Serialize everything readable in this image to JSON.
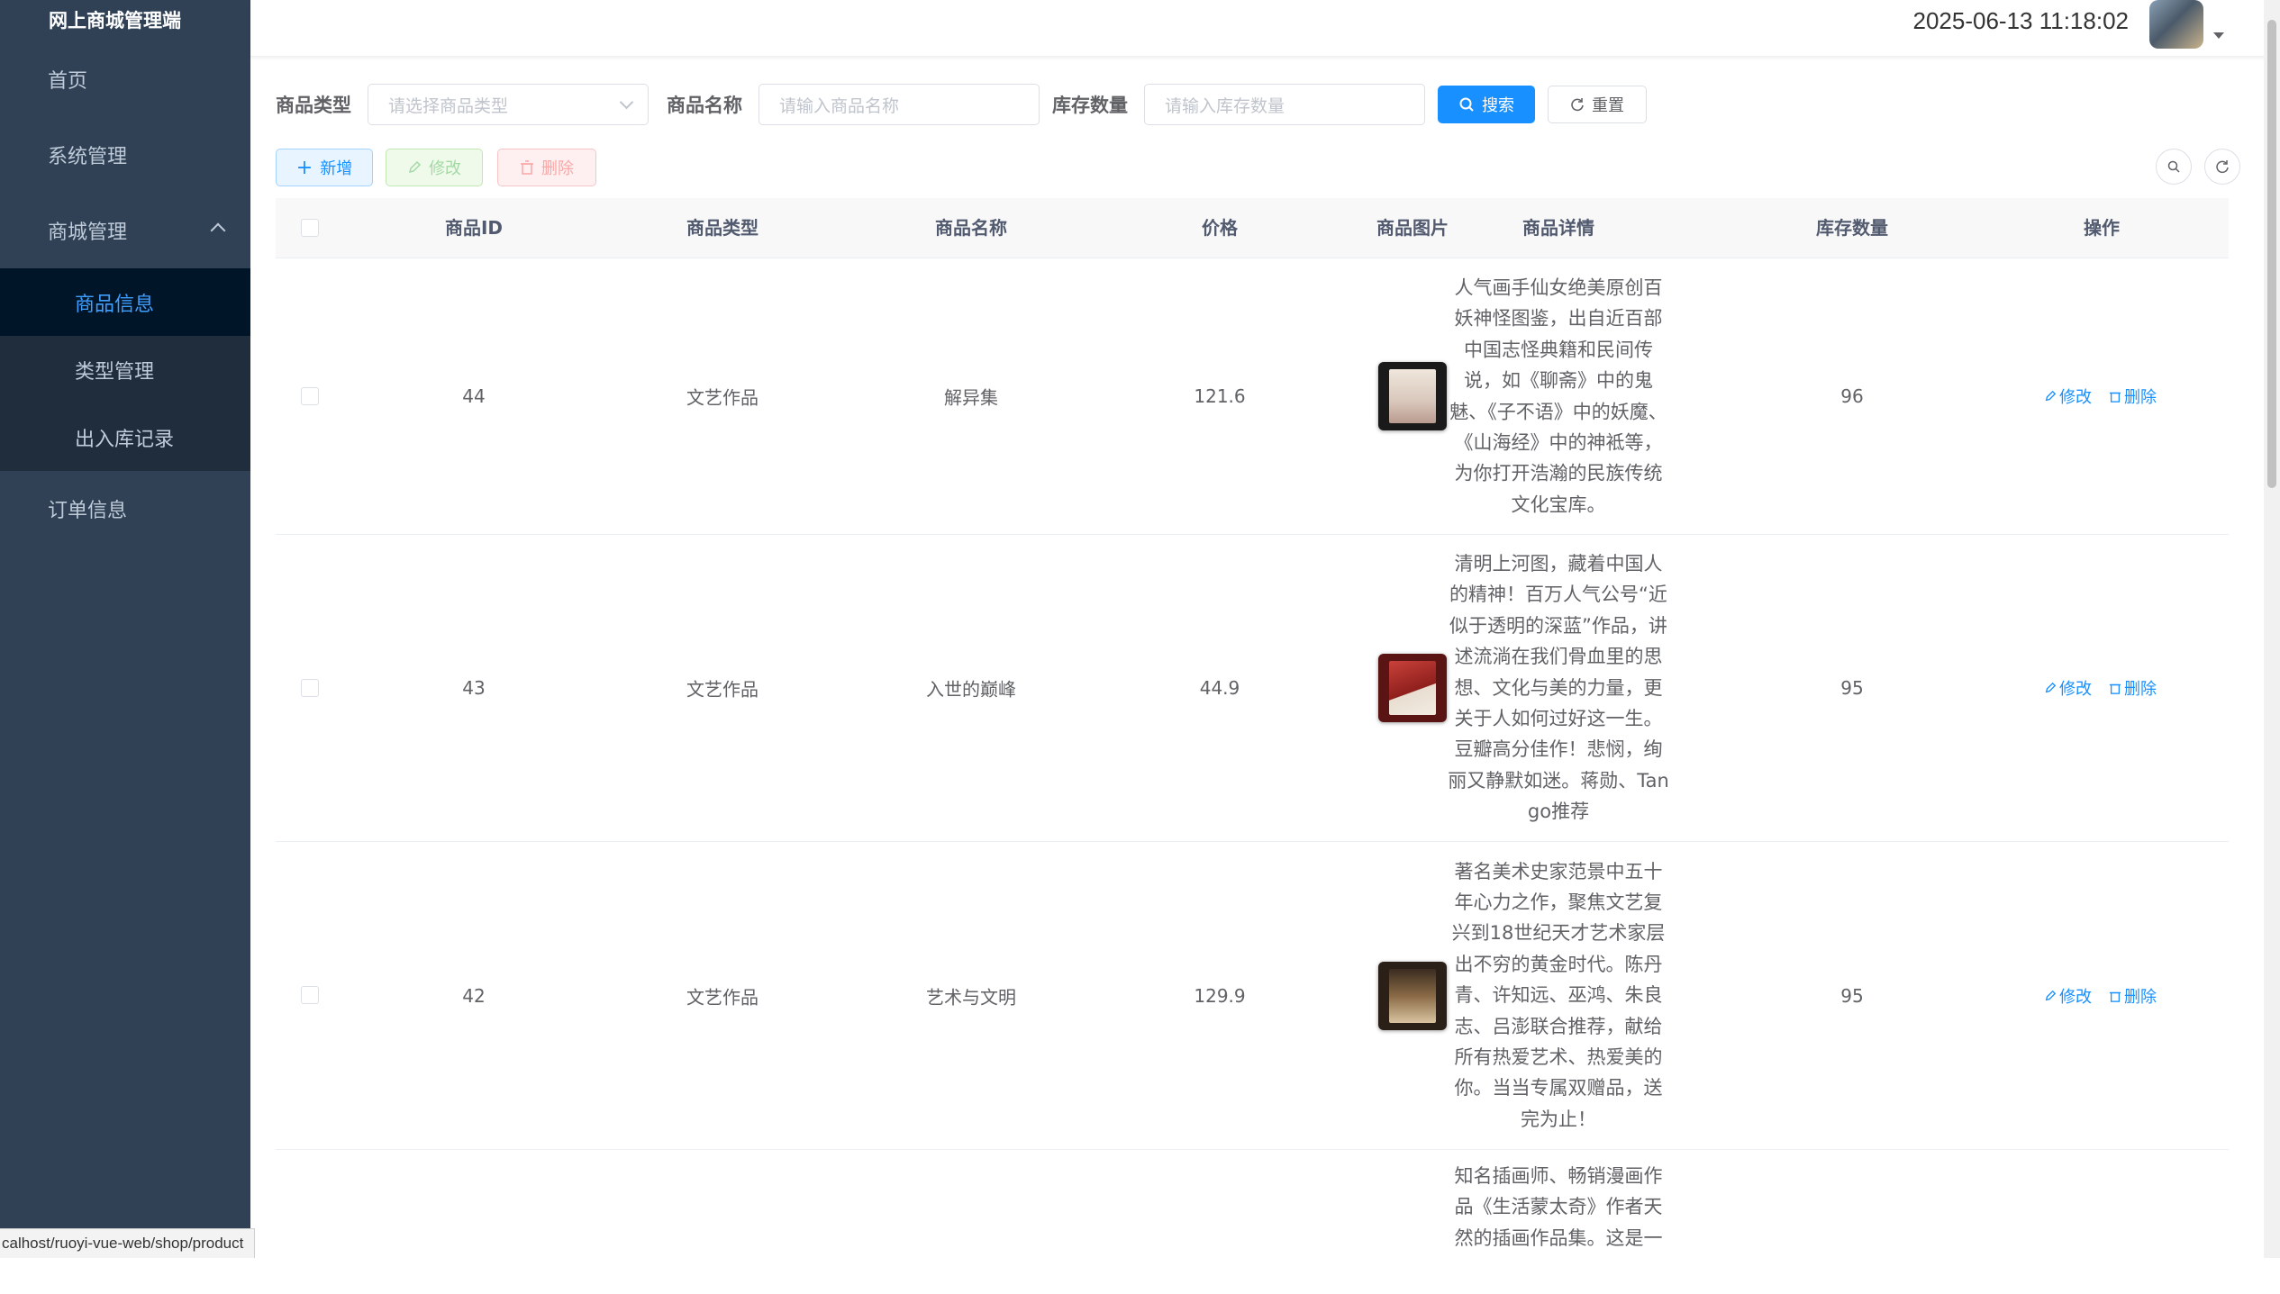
{
  "sidebar": {
    "title": "网上商城管理端",
    "menu": [
      {
        "label": "首页"
      },
      {
        "label": "系统管理"
      },
      {
        "label": "商城管理"
      },
      {
        "label": "订单信息"
      }
    ],
    "submenu": [
      {
        "label": "商品信息",
        "active": true
      },
      {
        "label": "类型管理"
      },
      {
        "label": "出入库记录"
      }
    ]
  },
  "header": {
    "datetime": "2025-06-13 11:18:02"
  },
  "search": {
    "type_label": "商品类型",
    "type_placeholder": "请选择商品类型",
    "name_label": "商品名称",
    "name_placeholder": "请输入商品名称",
    "stock_label": "库存数量",
    "stock_placeholder": "请输入库存数量",
    "search_button": "搜索",
    "reset_button": "重置"
  },
  "toolbar": {
    "add": "新增",
    "edit": "修改",
    "delete": "删除"
  },
  "table": {
    "headers": [
      "商品ID",
      "商品类型",
      "商品名称",
      "价格",
      "商品图片",
      "商品详情",
      "库存数量",
      "操作"
    ],
    "rows": [
      {
        "id": "44",
        "type": "文艺作品",
        "name": "解异集",
        "price": "121.6",
        "detail": "人气画手仙女绝美原创百妖神怪图鉴，出自近百部中国志怪典籍和民间传说，如《聊斋》中的鬼魅、《子不语》中的妖魔、《山海经》中的神袛等，为你打开浩瀚的民族传统文化宝库。",
        "stock": "96",
        "edit": "修改",
        "delete": "删除"
      },
      {
        "id": "43",
        "type": "文艺作品",
        "name": "入世的巅峰",
        "price": "44.9",
        "detail": "清明上河图，藏着中国人的精神！百万人气公号“近似于透明的深蓝”作品，讲述流淌在我们骨血里的思想、文化与美的力量，更关于人如何过好这一生。豆瓣高分佳作！悲悯，绚丽又静默如迷。蒋勋、Tango推荐",
        "stock": "95",
        "edit": "修改",
        "delete": "删除"
      },
      {
        "id": "42",
        "type": "文艺作品",
        "name": "艺术与文明",
        "price": "129.9",
        "detail": "著名美术史家范景中五十年心力之作，聚焦文艺复兴到18世纪天才艺术家层出不穷的黄金时代。陈丹青、许知远、巫鸿、朱良志、吕澎联合推荐，献给所有热爱艺术、热爱美的你。当当专属双赠品，送完为止！",
        "stock": "95",
        "edit": "修改",
        "delete": "删除"
      },
      {
        "id": "",
        "type": "",
        "name": "",
        "price": "",
        "detail": "知名插画师、畅销漫画作品《生活蒙太奇》作者天然的插画作品集。这是一",
        "stock": "",
        "edit": "",
        "delete": ""
      }
    ]
  },
  "statusbar": {
    "url": "calhost/ruoyi-vue-web/shop/product"
  },
  "colors": {
    "sidebar_bg": "#304156",
    "submenu_bg": "#1f2d3d",
    "active_bg": "#001528",
    "primary": "#1890ff"
  }
}
